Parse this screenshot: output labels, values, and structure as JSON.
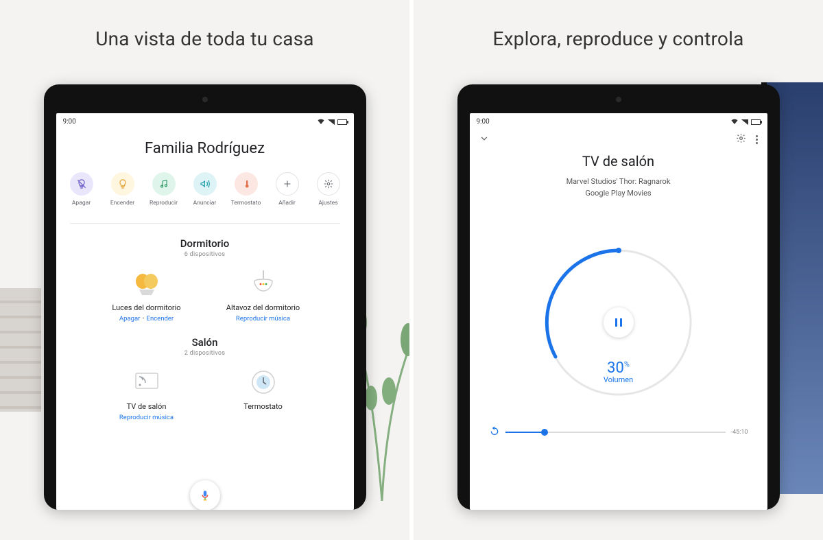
{
  "panel1": {
    "headline": "Una vista de toda tu casa",
    "statusTime": "9:00",
    "homeName": "Familia Rodríguez",
    "actions": [
      {
        "id": "off",
        "label": "Apagar",
        "bg": "#e9e6fb",
        "fg": "#6a5cc9",
        "icon": "bulb-off"
      },
      {
        "id": "on",
        "label": "Encender",
        "bg": "#fff6df",
        "fg": "#e8a33b",
        "icon": "bulb-on"
      },
      {
        "id": "play",
        "label": "Reproducir",
        "bg": "#dff5ec",
        "fg": "#1e8e5a",
        "icon": "note"
      },
      {
        "id": "announce",
        "label": "Anunciar",
        "bg": "#def3f6",
        "fg": "#1a9aa8",
        "icon": "announce"
      },
      {
        "id": "thermo",
        "label": "Termostato",
        "bg": "#fce7e2",
        "fg": "#e2704f",
        "icon": "thermo"
      },
      {
        "id": "add",
        "label": "Añadir",
        "bg": "#ffffff",
        "fg": "#5f6368",
        "icon": "plus",
        "outline": true
      },
      {
        "id": "settings",
        "label": "Ajustes",
        "bg": "#ffffff",
        "fg": "#5f6368",
        "icon": "gear",
        "outline": true
      }
    ],
    "rooms": [
      {
        "name": "Dormitorio",
        "sub": "6 dispositivos",
        "devices": [
          {
            "name": "Luces del dormitorio",
            "kind": "lights",
            "actions": [
              {
                "label": "Apagar",
                "link": true
              },
              {
                "label": "Encender",
                "link": true
              }
            ]
          },
          {
            "name": "Altavoz del dormitorio",
            "kind": "speaker",
            "actions": [
              {
                "label": "Reproducir música",
                "link": true
              }
            ]
          }
        ]
      },
      {
        "name": "Salón",
        "sub": "2 dispositivos",
        "devices": [
          {
            "name": "TV de salón",
            "kind": "tv",
            "actions": [
              {
                "label": "Reproducir música",
                "link": true
              }
            ]
          },
          {
            "name": "Termostato",
            "kind": "thermostat",
            "actions": []
          }
        ]
      }
    ]
  },
  "panel2": {
    "headline": "Explora, reproduce y controla",
    "statusTime": "9:00",
    "title": "TV de salón",
    "line1": "Marvel Studios' Thor: Ragnarok",
    "line2": "Google Play Movies",
    "volumePercent": "30",
    "volumeLabel": "Volumen",
    "duration": "-45:10"
  }
}
